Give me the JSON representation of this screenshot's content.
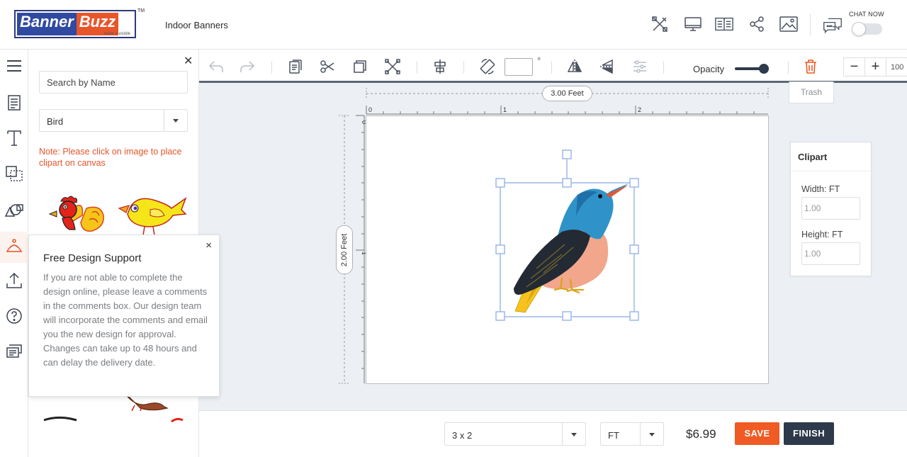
{
  "header": {
    "logo_banner": "Banner",
    "logo_buzz": "Buzz",
    "logo_tagline": "make it visible",
    "logo_tm": "TM",
    "product_name": "Indoor Banners",
    "chat_label": "CHAT NOW",
    "icons": [
      "tools-icon",
      "monitor-preview-icon",
      "book-guide-icon",
      "share-icon",
      "image-gallery-icon",
      "chat-bubble-icon"
    ]
  },
  "rail": {
    "items": [
      "menu-icon",
      "template-icon",
      "text-icon",
      "shapes-icon",
      "clipart-icon",
      "bird-clipart-icon",
      "upload-icon",
      "help-icon",
      "comments-icon"
    ]
  },
  "clipart_panel": {
    "search_placeholder": "Search by Name",
    "category_selected": "Bird",
    "note": "Note: Please click on image to place clipart on canvas"
  },
  "popup": {
    "title": "Free Design Support",
    "body": "If you are not able to complete the design online, please leave a comments in the comments box. Our design team will incorporate the comments and email you the new design for approval. Changes can take up to 48 hours and can delay the delivery date.",
    "close": "×"
  },
  "toolbar": {
    "angle_unit": "°",
    "opacity_label": "Opacity",
    "opacity_value": 1.0,
    "zoom_minus": "−",
    "zoom_plus": "+",
    "zoom_value": "100",
    "trash_tooltip": "Trash"
  },
  "canvas": {
    "width_label": "3.00 Feet",
    "height_label": "2.00 Feet",
    "ruler_h_ticks": [
      "0",
      "1",
      "2"
    ],
    "ruler_v_ticks": [
      "0",
      "1"
    ]
  },
  "clipart_props": {
    "title": "Clipart",
    "width_label": "Width: FT",
    "width_value": "1.00",
    "height_label": "Height: FT",
    "height_value": "1.00"
  },
  "bottom": {
    "size_selected": "3 x 2",
    "unit_selected": "FT",
    "price": "$6.99",
    "save_label": "SAVE",
    "finish_label": "FINISH"
  },
  "colors": {
    "accent": "#f05a24",
    "dark": "#2e3a4b",
    "brand_blue": "#2f4aa0",
    "note_orange": "#e8552a",
    "selection": "#9ab8e8"
  }
}
